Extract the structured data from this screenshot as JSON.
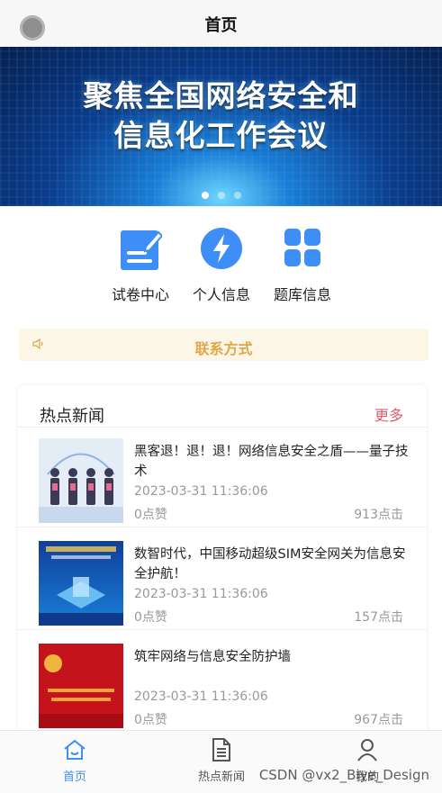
{
  "header": {
    "title": "首页"
  },
  "banner": {
    "line1": "聚焦全国网络安全和",
    "line2": "信息化工作会议",
    "indicator_count": 3,
    "active_index": 0
  },
  "menu": {
    "items": [
      {
        "label": "试卷中心",
        "icon": "edit-paper-icon"
      },
      {
        "label": "个人信息",
        "icon": "lightning-icon"
      },
      {
        "label": "题库信息",
        "icon": "grid-icon"
      }
    ]
  },
  "contact": {
    "label": "联系方式",
    "icon": "speaker-icon"
  },
  "news": {
    "section_title": "热点新闻",
    "more_label": "更多",
    "items": [
      {
        "title": "黑客退！退！退！网络信息安全之盾——量子技术",
        "date": "2023-03-31 11:36:06",
        "likes": "0点赞",
        "clicks": "913点击"
      },
      {
        "title": "数智时代，中国移动超级SIM安全网关为信息安全护航！",
        "date": "2023-03-31 11:36:06",
        "likes": "0点赞",
        "clicks": "157点击"
      },
      {
        "title": "筑牢网络与信息安全防护墙",
        "date": "2023-03-31 11:36:06",
        "likes": "0点赞",
        "clicks": "967点击"
      }
    ]
  },
  "tabbar": {
    "items": [
      {
        "label": "首页",
        "icon": "home-icon",
        "active": true
      },
      {
        "label": "热点新闻",
        "icon": "document-icon",
        "active": false
      },
      {
        "label": "我的",
        "icon": "user-icon",
        "active": false
      }
    ]
  },
  "watermark": "CSDN @vx2_Biye_Design",
  "colors": {
    "accent": "#3e8ef7",
    "more_link": "#e05a6b",
    "contact_text": "#e0a74a",
    "contact_bg": "#fcf6e6"
  }
}
